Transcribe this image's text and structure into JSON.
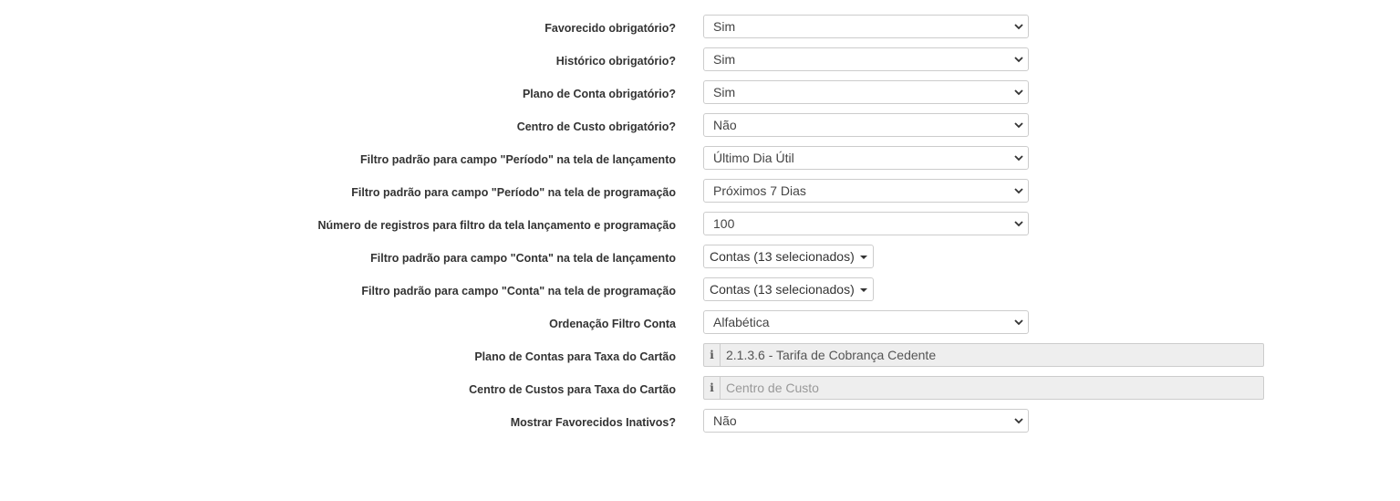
{
  "form": {
    "fields": [
      {
        "label": "Favorecido obrigatório?",
        "value": "Sim"
      },
      {
        "label": "Histórico obrigatório?",
        "value": "Sim"
      },
      {
        "label": "Plano de Conta obrigatório?",
        "value": "Sim"
      },
      {
        "label": "Centro de Custo obrigatório?",
        "value": "Não"
      },
      {
        "label": "Filtro padrão para campo \"Período\" na tela de lançamento",
        "value": "Último Dia Útil"
      },
      {
        "label": "Filtro padrão para campo \"Período\" na tela de programação",
        "value": "Próximos 7 Dias"
      },
      {
        "label": "Número de registros para filtro da tela lançamento e programação",
        "value": "100"
      },
      {
        "label": "Filtro padrão para campo \"Conta\" na tela de lançamento",
        "value": "Contas (13 selecionados)"
      },
      {
        "label": "Filtro padrão para campo \"Conta\" na tela de programação",
        "value": "Contas (13 selecionados)"
      },
      {
        "label": "Ordenação Filtro Conta",
        "value": "Alfabética"
      },
      {
        "label": "Plano de Contas para Taxa do Cartão",
        "value": "2.1.3.6 - Tarifa de Cobrança Cedente"
      },
      {
        "label": "Centro de Custos para Taxa do Cartão",
        "placeholder": "Centro de Custo"
      },
      {
        "label": "Mostrar Favorecidos Inativos?",
        "value": "Não"
      }
    ]
  },
  "icons": {
    "select_arrow": "chevron-down-icon",
    "multiselect_arrow": "caret-down-icon",
    "info_addon": "info-icon"
  },
  "colors": {
    "border": "#cccccc",
    "readonly_background": "#eeeeee",
    "label_text": "#333333"
  }
}
